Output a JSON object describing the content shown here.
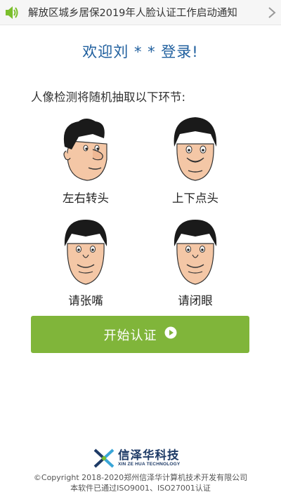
{
  "notice": {
    "text": "解放区城乡居保2019年人脸认证工作启动通知",
    "icon": "speaker-icon",
    "arrow_icon": "chevron-right-icon"
  },
  "welcome": "欢迎刘 * * 登录!",
  "hint": "人像检测将随机抽取以下环节:",
  "actions": [
    {
      "label": "左右转头",
      "icon": "turn-head-face-icon"
    },
    {
      "label": "上下点头",
      "icon": "nod-head-face-icon"
    },
    {
      "label": "请张嘴",
      "icon": "open-mouth-face-icon"
    },
    {
      "label": "请闭眼",
      "icon": "close-eyes-face-icon"
    }
  ],
  "start_button": {
    "label": "开始认证",
    "icon": "play-circle-icon"
  },
  "footer": {
    "logo_cn": "信泽华科技",
    "logo_en": "XIN ZE HUA TECHNOLOGY",
    "copyright": "©Copyright 2018-2020郑州信泽华计算机技术开发有限公司",
    "certification": "本软件已通过ISO9001、ISO27001认证"
  },
  "colors": {
    "accent": "#80b53a",
    "welcome": "#1f5f9e",
    "skin": "#f4c7a6",
    "hair": "#1a1a1a"
  }
}
